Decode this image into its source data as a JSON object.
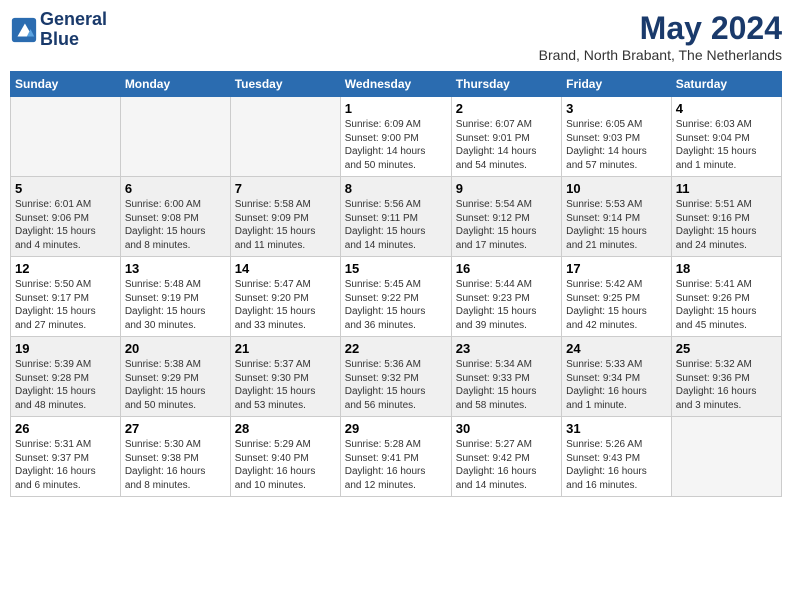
{
  "logo": {
    "line1": "General",
    "line2": "Blue"
  },
  "title": "May 2024",
  "subtitle": "Brand, North Brabant, The Netherlands",
  "weekdays": [
    "Sunday",
    "Monday",
    "Tuesday",
    "Wednesday",
    "Thursday",
    "Friday",
    "Saturday"
  ],
  "weeks": [
    [
      {
        "day": "",
        "info": "",
        "empty": true
      },
      {
        "day": "",
        "info": "",
        "empty": true
      },
      {
        "day": "",
        "info": "",
        "empty": true
      },
      {
        "day": "1",
        "info": "Sunrise: 6:09 AM\nSunset: 9:00 PM\nDaylight: 14 hours\nand 50 minutes."
      },
      {
        "day": "2",
        "info": "Sunrise: 6:07 AM\nSunset: 9:01 PM\nDaylight: 14 hours\nand 54 minutes."
      },
      {
        "day": "3",
        "info": "Sunrise: 6:05 AM\nSunset: 9:03 PM\nDaylight: 14 hours\nand 57 minutes."
      },
      {
        "day": "4",
        "info": "Sunrise: 6:03 AM\nSunset: 9:04 PM\nDaylight: 15 hours\nand 1 minute."
      }
    ],
    [
      {
        "day": "5",
        "info": "Sunrise: 6:01 AM\nSunset: 9:06 PM\nDaylight: 15 hours\nand 4 minutes.",
        "shaded": true
      },
      {
        "day": "6",
        "info": "Sunrise: 6:00 AM\nSunset: 9:08 PM\nDaylight: 15 hours\nand 8 minutes.",
        "shaded": true
      },
      {
        "day": "7",
        "info": "Sunrise: 5:58 AM\nSunset: 9:09 PM\nDaylight: 15 hours\nand 11 minutes.",
        "shaded": true
      },
      {
        "day": "8",
        "info": "Sunrise: 5:56 AM\nSunset: 9:11 PM\nDaylight: 15 hours\nand 14 minutes.",
        "shaded": true
      },
      {
        "day": "9",
        "info": "Sunrise: 5:54 AM\nSunset: 9:12 PM\nDaylight: 15 hours\nand 17 minutes.",
        "shaded": true
      },
      {
        "day": "10",
        "info": "Sunrise: 5:53 AM\nSunset: 9:14 PM\nDaylight: 15 hours\nand 21 minutes.",
        "shaded": true
      },
      {
        "day": "11",
        "info": "Sunrise: 5:51 AM\nSunset: 9:16 PM\nDaylight: 15 hours\nand 24 minutes.",
        "shaded": true
      }
    ],
    [
      {
        "day": "12",
        "info": "Sunrise: 5:50 AM\nSunset: 9:17 PM\nDaylight: 15 hours\nand 27 minutes."
      },
      {
        "day": "13",
        "info": "Sunrise: 5:48 AM\nSunset: 9:19 PM\nDaylight: 15 hours\nand 30 minutes."
      },
      {
        "day": "14",
        "info": "Sunrise: 5:47 AM\nSunset: 9:20 PM\nDaylight: 15 hours\nand 33 minutes."
      },
      {
        "day": "15",
        "info": "Sunrise: 5:45 AM\nSunset: 9:22 PM\nDaylight: 15 hours\nand 36 minutes."
      },
      {
        "day": "16",
        "info": "Sunrise: 5:44 AM\nSunset: 9:23 PM\nDaylight: 15 hours\nand 39 minutes."
      },
      {
        "day": "17",
        "info": "Sunrise: 5:42 AM\nSunset: 9:25 PM\nDaylight: 15 hours\nand 42 minutes."
      },
      {
        "day": "18",
        "info": "Sunrise: 5:41 AM\nSunset: 9:26 PM\nDaylight: 15 hours\nand 45 minutes."
      }
    ],
    [
      {
        "day": "19",
        "info": "Sunrise: 5:39 AM\nSunset: 9:28 PM\nDaylight: 15 hours\nand 48 minutes.",
        "shaded": true
      },
      {
        "day": "20",
        "info": "Sunrise: 5:38 AM\nSunset: 9:29 PM\nDaylight: 15 hours\nand 50 minutes.",
        "shaded": true
      },
      {
        "day": "21",
        "info": "Sunrise: 5:37 AM\nSunset: 9:30 PM\nDaylight: 15 hours\nand 53 minutes.",
        "shaded": true
      },
      {
        "day": "22",
        "info": "Sunrise: 5:36 AM\nSunset: 9:32 PM\nDaylight: 15 hours\nand 56 minutes.",
        "shaded": true
      },
      {
        "day": "23",
        "info": "Sunrise: 5:34 AM\nSunset: 9:33 PM\nDaylight: 15 hours\nand 58 minutes.",
        "shaded": true
      },
      {
        "day": "24",
        "info": "Sunrise: 5:33 AM\nSunset: 9:34 PM\nDaylight: 16 hours\nand 1 minute.",
        "shaded": true
      },
      {
        "day": "25",
        "info": "Sunrise: 5:32 AM\nSunset: 9:36 PM\nDaylight: 16 hours\nand 3 minutes.",
        "shaded": true
      }
    ],
    [
      {
        "day": "26",
        "info": "Sunrise: 5:31 AM\nSunset: 9:37 PM\nDaylight: 16 hours\nand 6 minutes."
      },
      {
        "day": "27",
        "info": "Sunrise: 5:30 AM\nSunset: 9:38 PM\nDaylight: 16 hours\nand 8 minutes."
      },
      {
        "day": "28",
        "info": "Sunrise: 5:29 AM\nSunset: 9:40 PM\nDaylight: 16 hours\nand 10 minutes."
      },
      {
        "day": "29",
        "info": "Sunrise: 5:28 AM\nSunset: 9:41 PM\nDaylight: 16 hours\nand 12 minutes."
      },
      {
        "day": "30",
        "info": "Sunrise: 5:27 AM\nSunset: 9:42 PM\nDaylight: 16 hours\nand 14 minutes."
      },
      {
        "day": "31",
        "info": "Sunrise: 5:26 AM\nSunset: 9:43 PM\nDaylight: 16 hours\nand 16 minutes."
      },
      {
        "day": "",
        "info": "",
        "empty": true
      }
    ]
  ]
}
